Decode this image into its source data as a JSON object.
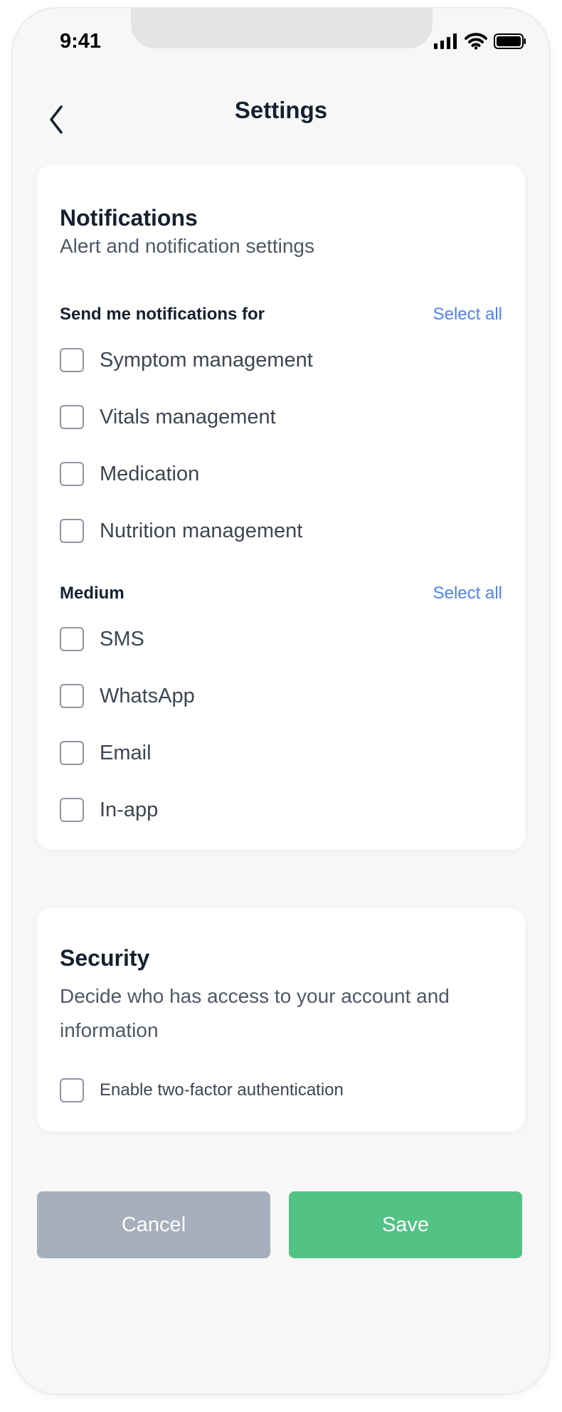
{
  "status_bar": {
    "time": "9:41"
  },
  "header": {
    "title": "Settings"
  },
  "notifications": {
    "title": "Notifications",
    "subtitle": "Alert and notification settings",
    "send_label": "Send me notifications for",
    "select_all": "Select all",
    "topics": [
      "Symptom management",
      "Vitals management",
      "Medication",
      "Nutrition management"
    ],
    "medium_label": "Medium",
    "medium_select_all": "Select all",
    "mediums": [
      "SMS",
      "WhatsApp",
      "Email",
      "In-app"
    ]
  },
  "security": {
    "title": "Security",
    "subtitle": "Decide who has access to your account and information",
    "two_factor": "Enable two-factor authentication"
  },
  "actions": {
    "cancel": "Cancel",
    "save": "Save"
  },
  "colors": {
    "accent_link": "#4f82ee",
    "save": "#52c285",
    "cancel": "#a6afbb"
  }
}
